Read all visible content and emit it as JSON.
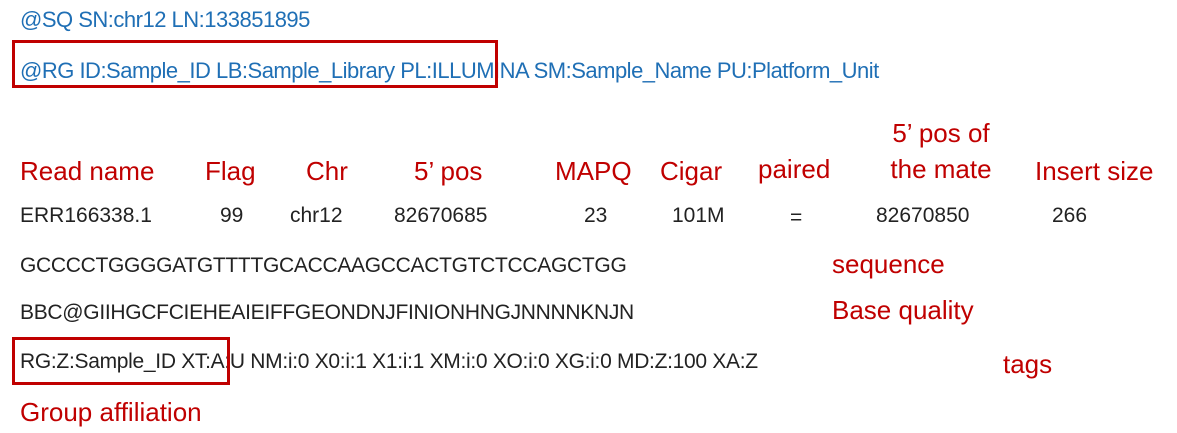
{
  "header": {
    "sq_line": "@SQ SN:chr12 LN:133851895",
    "rg_line": "@RG ID:Sample_ID LB:Sample_Library PL:ILLUMINA SM:Sample_Name PU:Platform_Unit"
  },
  "labels": {
    "read_name": "Read name",
    "flag": "Flag",
    "chr": "Chr",
    "pos": "5’ pos",
    "mapq": "MAPQ",
    "cigar": "Cigar",
    "paired": "paired",
    "mate_pos_line1": "5’ pos of",
    "mate_pos_line2": "the mate",
    "insert_size": "Insert size",
    "sequence": "sequence",
    "base_quality": "Base quality",
    "tags": "tags",
    "group_affiliation": "Group affiliation"
  },
  "values": {
    "read_name": "ERR166338.1",
    "flag": "99",
    "chr": "chr12",
    "pos": "82670685",
    "mapq": "23",
    "cigar": "101M",
    "paired": "=",
    "mate_pos": "82670850",
    "insert_size": "266"
  },
  "sequence": "GCCCCTGGGGATGTTTTGCACCAAGCCACTGTCTCCAGCTGG",
  "quality": "BBC@GIIHGCFCIEHEAIEIFFGEONDNJFINIONHNGJNNNNKNJN",
  "tags_line": "RG:Z:Sample_ID XT:A:U NM:i:0 X0:i:1 X1:i:1 XM:i:0 XO:i:0 XG:i:0 MD:Z:100 XA:Z",
  "colors": {
    "header_blue": "#1f6fb5",
    "label_red": "#c00000",
    "value_dark": "#222222"
  }
}
